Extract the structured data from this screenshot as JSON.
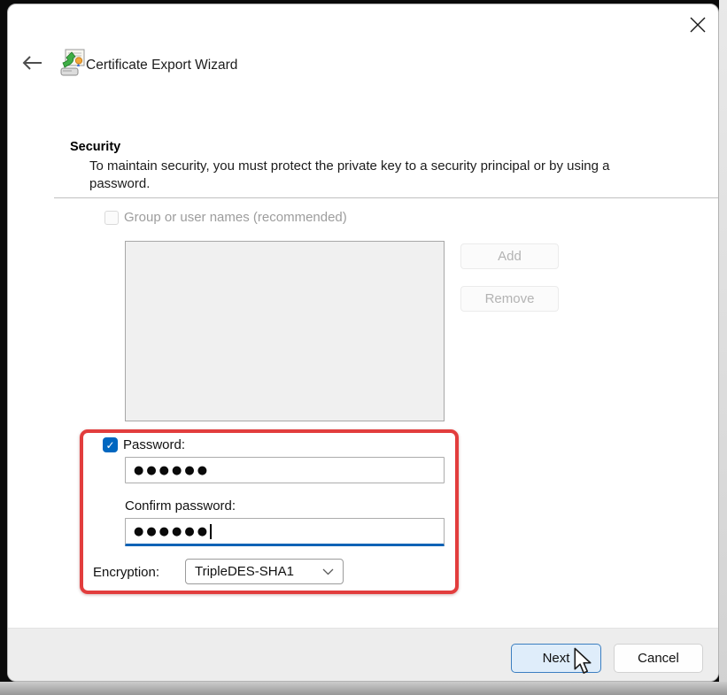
{
  "header": {
    "title": "Certificate Export Wizard"
  },
  "section": {
    "heading": "Security",
    "description": "To maintain security, you must protect the private key to a security principal or by using a password."
  },
  "group_names": {
    "label": "Group or user names (recommended)",
    "checked": false,
    "add_label": "Add",
    "remove_label": "Remove",
    "list_items": []
  },
  "password": {
    "checkbox_label": "Password:",
    "checked": true,
    "value_masked": "●●●●●●",
    "confirm_label": "Confirm password:",
    "confirm_value_masked": "●●●●●●"
  },
  "encryption": {
    "label": "Encryption:",
    "selected": "TripleDES-SHA1"
  },
  "footer": {
    "next_label": "Next",
    "cancel_label": "Cancel"
  },
  "icons": {
    "check": "✓"
  },
  "colors": {
    "accent": "#0067c0",
    "focus_underline": "#0f63b6",
    "annotation_red": "#e23d3d",
    "next_button_bg": "#dfedfa",
    "footer_bg": "#ededed",
    "disabled_text": "#9d9d9d",
    "listbox_bg": "#f0f0f0"
  }
}
